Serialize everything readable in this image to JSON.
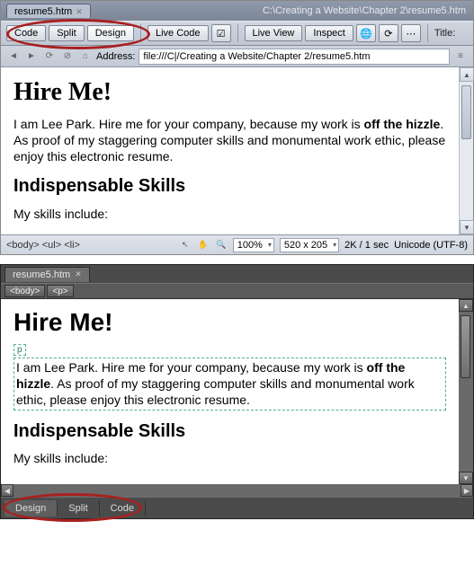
{
  "panel1": {
    "tab": {
      "name": "resume5.htm"
    },
    "title_path": "C:\\Creating a Website\\Chapter 2\\resume5.htm",
    "view_buttons": {
      "code": "Code",
      "split": "Split",
      "design": "Design"
    },
    "toolbar": {
      "live_code": "Live Code",
      "live_view": "Live View",
      "inspect": "Inspect",
      "title_label": "Title:"
    },
    "address": {
      "label": "Address:",
      "value": "file:///C|/Creating a Website/Chapter 2/resume5.htm"
    },
    "doc": {
      "h1": "Hire Me!",
      "p_parts": {
        "a": "I am Lee Park. Hire me for your company, because my work is ",
        "b": "off the hizzle",
        "c": ". As proof of my staggering computer skills and monumental work ethic, please enjoy this electronic resume."
      },
      "h2": "Indispensable Skills",
      "skills_intro": "My skills include:"
    },
    "status": {
      "tags": "<body> <ul> <li>",
      "zoom": "100%",
      "dims": "520 x 205",
      "size_time": "2K / 1 sec",
      "encoding": "Unicode (UTF-8)"
    }
  },
  "panel2": {
    "tab": {
      "name": "resume5.htm"
    },
    "tagpath": {
      "a": "<body>",
      "b": "<p>"
    },
    "ptag": "p",
    "doc": {
      "h1": "Hire Me!",
      "p_parts": {
        "a": "I am Lee Park. Hire me for your company, because my work is ",
        "b": "off the hizzle",
        "c": ". As proof of my staggering computer skills and monumental work ethic, please enjoy this electronic resume."
      },
      "h2": "Indispensable Skills",
      "skills_intro": "My skills include:"
    },
    "bottom": {
      "design": "Design",
      "split": "Split",
      "code": "Code"
    }
  }
}
